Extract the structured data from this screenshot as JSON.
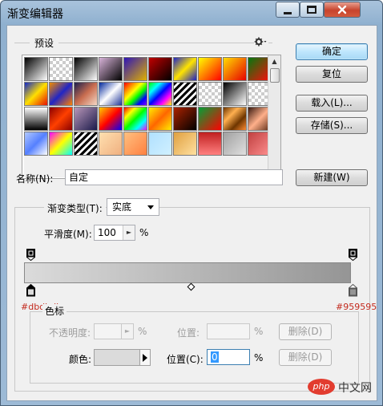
{
  "window": {
    "title": "渐变编辑器"
  },
  "buttons": {
    "ok": "确定",
    "reset": "复位",
    "load": "载入(L)...",
    "save": "存储(S)...",
    "new": "新建(W)"
  },
  "presets": {
    "label": "预设",
    "gear_icon": "gear-icon",
    "swatches": [
      "linear-gradient(135deg,#000,#fff)",
      "repeating-conic-gradient(#ccc 0 25%,#fff 0 50%) 0 0/8px 8px",
      "linear-gradient(135deg,#000,#fff)",
      "linear-gradient(135deg,#d8b3d9,#000)",
      "linear-gradient(135deg,#2d14b8,#e0b000)",
      "linear-gradient(135deg,#c10000,#000)",
      "linear-gradient(135deg,#2026c7,#ffe400,#1d1fc5)",
      "linear-gradient(135deg,#ff0,#f00)",
      "linear-gradient(135deg,#ffde00,#e70000)",
      "linear-gradient(135deg,#03780e,#ff0b0b)",
      "linear-gradient(135deg,#1027c8,#ffdf00,#e51100)",
      "linear-gradient(135deg,#f18a00,#2025c5,#ff8000)",
      "linear-gradient(135deg,#1b1f4e,#c96d4f,#f5d8c6)",
      "linear-gradient(135deg,#02299c,#ffffff,#1f3699)",
      "linear-gradient(135deg,#ff0000,#ff8000,#ffff00,#00ff00,#0000ff,#8000ff)",
      "linear-gradient(135deg,#00ff00,#00ffff,#0000ff,#ff00ff,#ffff00)",
      "repeating-linear-gradient(135deg,#000 0 3px,#fff 3px 6px)",
      "repeating-conic-gradient(#ccc 0 25%,#fff 0 50%) 0 0/8px 8px",
      "linear-gradient(135deg,#000,#fff)",
      "repeating-conic-gradient(#ccc 0 25%,#fff 0 50%) 0 0/8px 8px",
      "linear-gradient(180deg,#fff,#000)",
      "linear-gradient(135deg,#8b0000,#ff4000,#8b0000)",
      "linear-gradient(135deg,#b896b8,#1a1a4a)",
      "linear-gradient(135deg,#ffcc00,#ff0000,#0000ff)",
      "linear-gradient(135deg,#ff0000,#ffff00,#00ff00,#00ffff,#ff00ff)",
      "linear-gradient(135deg,#ffee00,#ff6600,#ffee00)",
      "linear-gradient(135deg,#aa2200,#000)",
      "linear-gradient(135deg,#02a035,#ff0000)",
      "linear-gradient(135deg,#6e3500,#ffb050,#6e3500,#ff8b33)",
      "linear-gradient(135deg,#3a1a10,#ffb08a,#5a2a15)",
      "linear-gradient(135deg,#b0c8ff,#5580ff,#fff)",
      "linear-gradient(135deg,#ff00ff,#ffff00,#00ffff)",
      "repeating-linear-gradient(135deg,#000 0 3px,#fff 3px 6px)",
      "linear-gradient(135deg,#ffe0b0,#f0b080)",
      "linear-gradient(135deg,#ffc080,#ff8040)",
      "linear-gradient(135deg,#b0e0ff,#d0f0ff)",
      "linear-gradient(135deg,#e0a040,#ffe0a0)",
      "linear-gradient(180deg,#c02020,#ff8080)",
      "linear-gradient(135deg,#a0a0a0,#e0e0e0)",
      "linear-gradient(135deg,#c04040,#ff9090)"
    ]
  },
  "name_row": {
    "label": "名称(N):",
    "value": "自定"
  },
  "gradient": {
    "type_label": "渐变类型(T):",
    "type_value": "实底",
    "smoothness_label": "平滑度(M):",
    "smoothness_value": "100",
    "percent": "%",
    "start_color": "#dbdbdb",
    "end_color": "#959595",
    "start_code": "#dbdbdb",
    "end_code": "#959595"
  },
  "stops": {
    "title": "色标",
    "opacity_label": "不透明度:",
    "opacity_value": "",
    "opacity_pct": "%",
    "location_label_top": "位置:",
    "location_value_top": "",
    "location_pct_top": "%",
    "delete_top": "删除(D)",
    "color_label": "颜色:",
    "color_swatch": "#dbdbdb",
    "location_label": "位置(C):",
    "location_value": "0",
    "location_pct": "%",
    "delete_bottom": "删除(D)"
  },
  "watermark": {
    "text": "中文网",
    "logo": "php"
  }
}
